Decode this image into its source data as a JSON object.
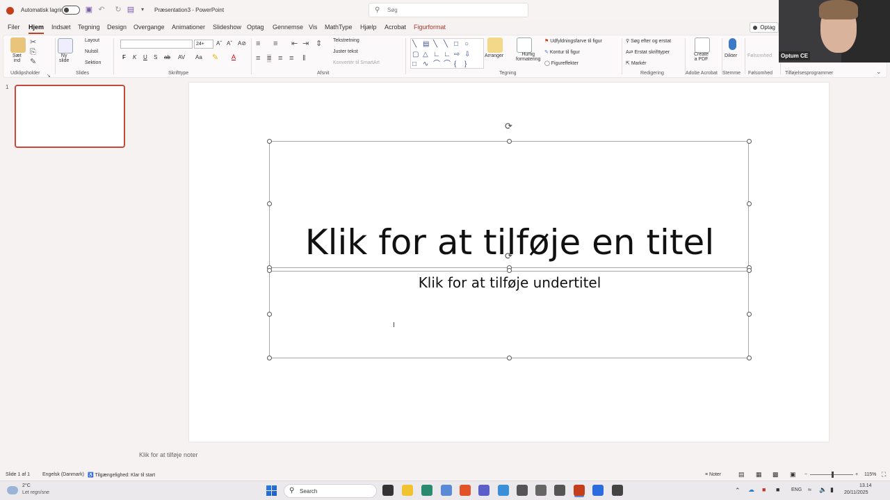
{
  "titlebar": {
    "autosave_label": "Automatisk lagring",
    "doc_title": "Præsentation3 - PowerPoint",
    "search_placeholder": "Søg"
  },
  "tabs": [
    "Filer",
    "Hjem",
    "Indsæt",
    "Tegning",
    "Design",
    "Overgange",
    "Animationer",
    "Slideshow",
    "Optag",
    "Gennemse",
    "Vis",
    "MathType",
    "Hjælp",
    "Acrobat",
    "Figurformat"
  ],
  "active_tab": "Hjem",
  "record_button": "Optag",
  "ribbon": {
    "clipboard": {
      "paste": "Sæt\nind",
      "group": "Udklipsholder"
    },
    "slides": {
      "new_slide": "Ny\nslide",
      "layout": "Layout",
      "reset": "Nulstil",
      "section": "Sektion",
      "group": "Slides"
    },
    "font": {
      "size": "24+",
      "bold": "F",
      "italic": "K",
      "underline": "U",
      "shadow": "S",
      "strike": "ab",
      "group": "Skrifttype"
    },
    "paragraph": {
      "text_direction": "Tekstretning",
      "align_text": "Juster tekst",
      "smartart": "Konvertér til SmartArt",
      "group": "Afsnit"
    },
    "drawing": {
      "arrange": "Arranger",
      "quick_styles": "Hurtig\nformatering",
      "fill": "Udfyldningsfarve til figur",
      "outline": "Kontur til figur",
      "effects": "Figureffekter",
      "group": "Tegning"
    },
    "editing": {
      "find_replace": "Søg efter og erstat",
      "replace_fonts": "Erstat skrifttyper",
      "select": "Markér",
      "group": "Redigering"
    },
    "acrobat": {
      "create_pdf": "Create\na PDF",
      "group": "Adobe Acrobat"
    },
    "voice": {
      "dictate": "Dikter",
      "group": "Stemme"
    },
    "sensitivity": {
      "label": "Følsomhed",
      "group": "Følsomhed"
    },
    "addins": {
      "group": "Tilføjelsesprogrammer"
    }
  },
  "webcam": {
    "name": "Optum CE"
  },
  "thumbnail": {
    "number": "1"
  },
  "slide": {
    "title_placeholder": "Klik for at tilføje en titel",
    "subtitle_placeholder": "Klik for at tilføje undertitel"
  },
  "notes_placeholder": "Klik for at tilføje noter",
  "status": {
    "slide_count": "Slide 1 af 1",
    "language": "Engelsk (Danmark)",
    "accessibility": "Tilgængelighed: Klar til start",
    "notes": "Noter",
    "zoom": "115%"
  },
  "taskbar": {
    "weather_temp": "2°C",
    "weather_desc": "Let regn/sne",
    "search": "Search",
    "lang": "ENG",
    "time": "13.14",
    "date": "20/11/2025"
  },
  "colors": {
    "accent": "#c43e1c",
    "context_tab": "#b2352a",
    "selection": "#c8473a"
  }
}
